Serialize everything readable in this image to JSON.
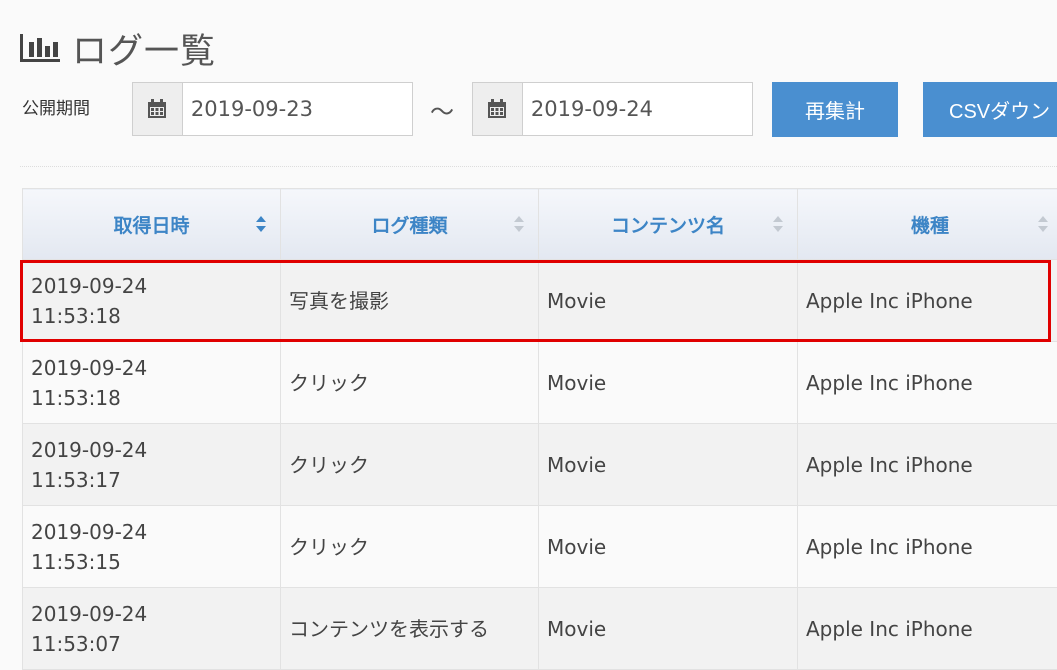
{
  "page": {
    "title": "ログ一覧"
  },
  "filter": {
    "period_label": "公開期間",
    "start_date": "2019-09-23",
    "separator": "～",
    "end_date": "2019-09-24",
    "recalc_label": "再集計",
    "csv_label": "CSVダウン"
  },
  "table": {
    "columns": [
      "取得日時",
      "ログ種類",
      "コンテンツ名",
      "機種"
    ],
    "rows": [
      {
        "date": "2019-09-24",
        "time": "11:53:18",
        "type": "写真を撮影",
        "content": "Movie",
        "device": "Apple Inc iPhone"
      },
      {
        "date": "2019-09-24",
        "time": "11:53:18",
        "type": "クリック",
        "content": "Movie",
        "device": "Apple Inc iPhone"
      },
      {
        "date": "2019-09-24",
        "time": "11:53:17",
        "type": "クリック",
        "content": "Movie",
        "device": "Apple Inc iPhone"
      },
      {
        "date": "2019-09-24",
        "time": "11:53:15",
        "type": "クリック",
        "content": "Movie",
        "device": "Apple Inc iPhone"
      },
      {
        "date": "2019-09-24",
        "time": "11:53:07",
        "type": "コンテンツを表示する",
        "content": "Movie",
        "device": "Apple Inc iPhone"
      }
    ]
  },
  "colors": {
    "accent": "#4a8fd0",
    "header_text": "#3d85c6",
    "highlight": "#e00000"
  },
  "icons": {
    "title": "bar-chart-icon",
    "date": "calendar-icon",
    "sort": "sort-icon"
  }
}
